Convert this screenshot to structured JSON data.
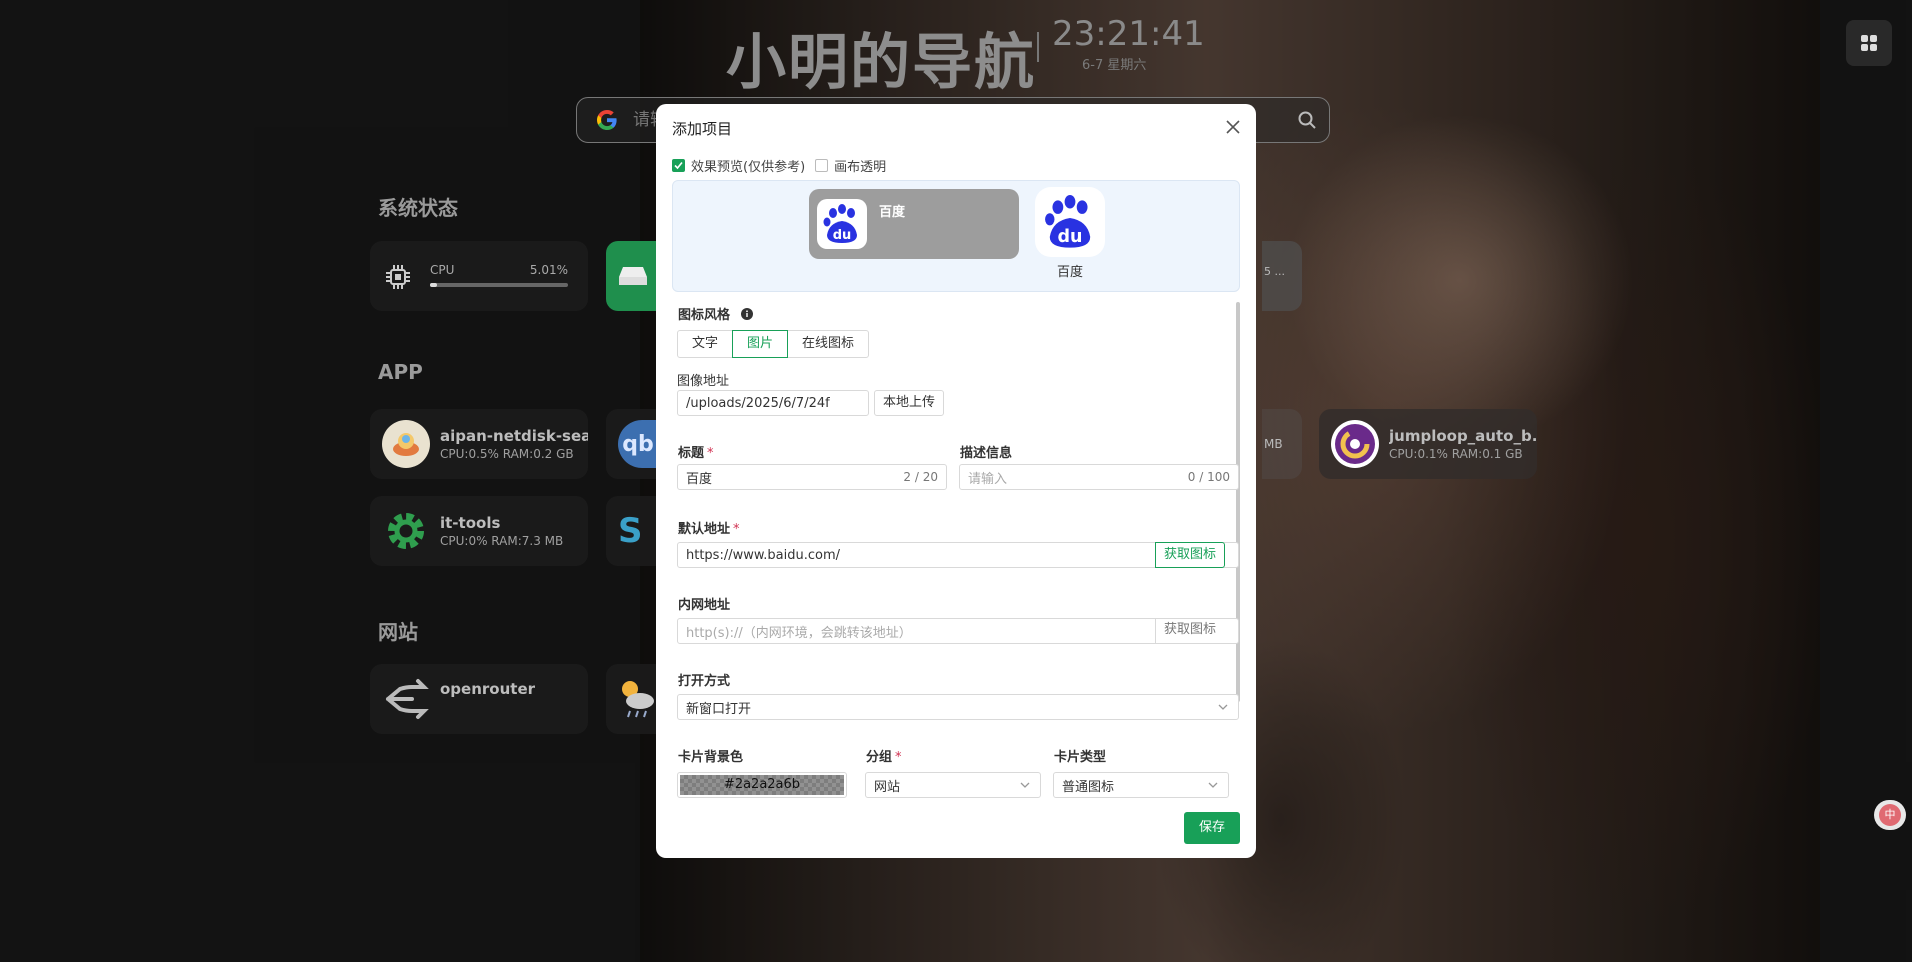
{
  "header": {
    "site_title": "小明的导航",
    "time": "23:21:41",
    "date": "6-7 星期六"
  },
  "search": {
    "placeholder": "请输入搜索内容"
  },
  "sections": {
    "system": "系统状态",
    "app": "APP",
    "site": "网站"
  },
  "system_status": {
    "cpu_label": "CPU",
    "cpu_value": "5.01%",
    "cpu_fraction": 0.0501,
    "partial_card_text": "5 ..."
  },
  "apps": [
    {
      "name": "aipan-netdisk-sea...",
      "stats": "CPU:0.5% RAM:0.2 GB"
    },
    {
      "name": "it-tools",
      "stats": "CPU:0% RAM:7.3 MB"
    },
    {
      "name": "jumploop_auto_b...",
      "stats": "CPU:0.1% RAM:0.1 GB"
    },
    {
      "partial": "MB"
    }
  ],
  "sites": [
    {
      "name": "openrouter"
    }
  ],
  "modal": {
    "title": "添加项目",
    "preview_checkbox": "效果预览(仅供参考)",
    "transparent_checkbox": "画布透明",
    "preview_title": "百度",
    "preview_label": "百度",
    "icon_style_label": "图标风格",
    "icon_style_options": [
      "文字",
      "图片",
      "在线图标"
    ],
    "icon_style_selected": "图片",
    "image_url_label": "图像地址",
    "image_url_value": "/uploads/2025/6/7/24f",
    "upload_button": "本地上传",
    "title_label": "标题",
    "title_value": "百度",
    "title_count": "2 / 20",
    "desc_label": "描述信息",
    "desc_placeholder": "请输入",
    "desc_count": "0 / 100",
    "default_url_label": "默认地址",
    "default_url_value": "https://www.baidu.com/",
    "fetch_icon_button": "获取图标",
    "lan_url_label": "内网地址",
    "lan_url_placeholder": "http(s)://（内网环境，会跳转该地址）",
    "fetch_icon_button_2": "获取图标",
    "open_mode_label": "打开方式",
    "open_mode_value": "新窗口打开",
    "card_bg_label": "卡片背景色",
    "card_bg_value": "#2a2a2a6b",
    "group_label": "分组",
    "group_value": "网站",
    "card_type_label": "卡片类型",
    "card_type_value": "普通图标",
    "save_button": "保存",
    "required_mark": "*"
  },
  "colors": {
    "accent": "#18a058",
    "baidu_blue": "#2932e1",
    "required": "#d03050"
  }
}
